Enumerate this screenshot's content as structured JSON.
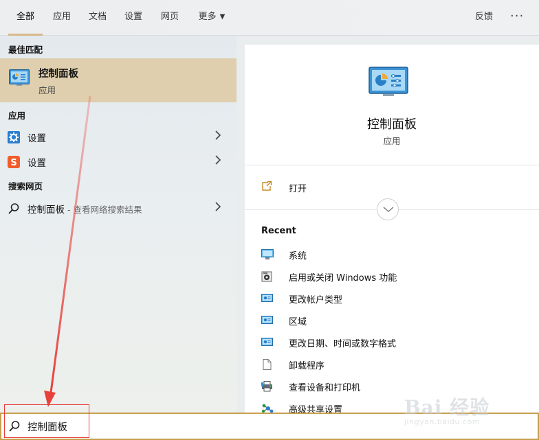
{
  "tabs": [
    {
      "label": "全部",
      "active": true
    },
    {
      "label": "应用"
    },
    {
      "label": "文档"
    },
    {
      "label": "设置"
    },
    {
      "label": "网页"
    },
    {
      "label": "更多"
    }
  ],
  "header": {
    "feedback": "反馈",
    "more_options": "···"
  },
  "left": {
    "best_match_heading": "最佳匹配",
    "best_match": {
      "title": "控制面板",
      "subtitle": "应用",
      "icon": "control-panel-icon"
    },
    "apps_heading": "应用",
    "apps": [
      {
        "label": "设置",
        "icon": "gear-icon"
      },
      {
        "label": "设置",
        "icon": "sogou-s-icon"
      }
    ],
    "web_heading": "搜索网页",
    "web_result": {
      "label": "控制面板",
      "suffix": " - 查看网络搜索结果",
      "icon": "search-icon"
    }
  },
  "detail": {
    "title": "控制面板",
    "subtitle": "应用",
    "open_label": "打开",
    "recent_heading": "Recent",
    "recent": [
      {
        "label": "系统",
        "icon": "monitor-icon"
      },
      {
        "label": "启用或关闭 Windows 功能",
        "icon": "windows-features-icon"
      },
      {
        "label": "更改帐户类型",
        "icon": "control-panel-small-icon"
      },
      {
        "label": "区域",
        "icon": "control-panel-small-icon"
      },
      {
        "label": "更改日期、时间或数字格式",
        "icon": "control-panel-small-icon"
      },
      {
        "label": "卸载程序",
        "icon": "document-icon"
      },
      {
        "label": "查看设备和打印机",
        "icon": "printer-icon"
      },
      {
        "label": "高级共享设置",
        "icon": "network-share-icon"
      }
    ]
  },
  "search": {
    "value": "控制面板"
  },
  "colors": {
    "accent": "#d6b98a",
    "selection": "#dfcfae",
    "search_border": "#c6a04e",
    "annotation": "#e8403a"
  },
  "watermark": {
    "line1": "Bai 经验",
    "line2": "jingyan.baidu.com"
  }
}
